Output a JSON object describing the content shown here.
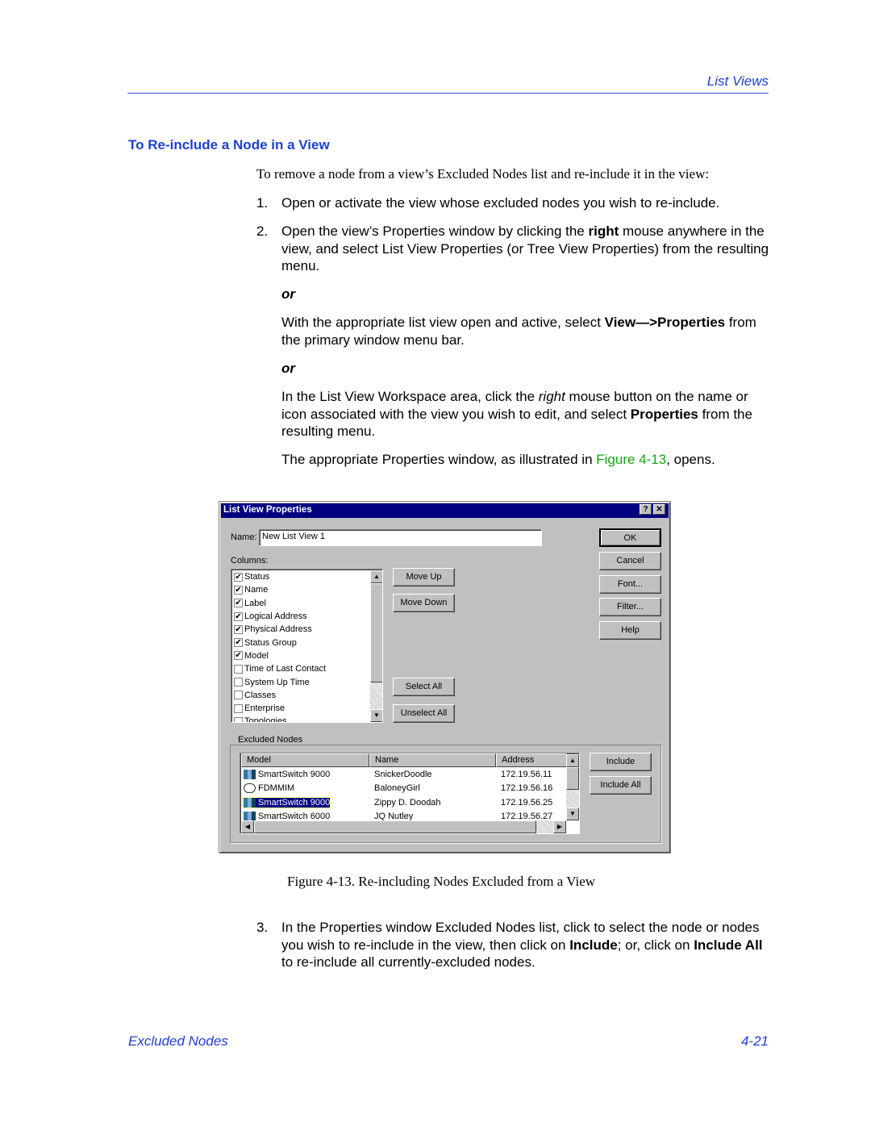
{
  "header": {
    "section": "List Views"
  },
  "heading": "To Re-include a Node in a View",
  "intro": "To remove a node from a view’s Excluded Nodes list and re-include it in the view:",
  "steps": [
    {
      "num": "1.",
      "text": "Open or activate the view whose excluded nodes you wish to re-include."
    },
    {
      "num": "2.",
      "pre": "Open the view’s Properties window by clicking the ",
      "bold": "right",
      "post": " mouse anywhere in the view, and select List View Properties (or Tree View Properties) from the resulting menu."
    },
    {
      "num": "3.",
      "pre": "In the Properties window Excluded Nodes list, click to select the node or nodes you wish to re-include in the view, then click on ",
      "bold": "Include",
      "mid": "; or, click on ",
      "bold2": "Include All",
      "post": " to re-include all currently-excluded nodes."
    }
  ],
  "or1": "or",
  "alt1": {
    "pre": "With the appropriate list view open and active, select ",
    "bold": "View—>Properties",
    "post": " from the primary window menu bar."
  },
  "or2": "or",
  "alt2": {
    "pre": "In the List View Workspace area, click the ",
    "italic": "right",
    "mid": " mouse button on the name or icon associated with the view you wish to edit, and select ",
    "bold": "Properties",
    "post": " from the resulting menu."
  },
  "result": {
    "pre": "The appropriate Properties window, as illustrated in ",
    "link": "Figure 4-13",
    "post": ", opens."
  },
  "dialog": {
    "title": "List View Properties",
    "help_btn": "?",
    "close_btn": "✕",
    "name_label": "Name:",
    "name_value": "New List View 1",
    "columns_label": "Columns:",
    "columns": [
      {
        "label": "Status",
        "checked": true
      },
      {
        "label": "Name",
        "checked": true
      },
      {
        "label": "Label",
        "checked": true
      },
      {
        "label": "Logical Address",
        "checked": true
      },
      {
        "label": "Physical Address",
        "checked": true
      },
      {
        "label": "Status Group",
        "checked": true
      },
      {
        "label": "Model",
        "checked": true
      },
      {
        "label": "Time of Last Contact",
        "checked": false
      },
      {
        "label": "System Up Time",
        "checked": false
      },
      {
        "label": "Classes",
        "checked": false
      },
      {
        "label": "Enterprise",
        "checked": false
      },
      {
        "label": "Topologies",
        "checked": false
      }
    ],
    "buttons": {
      "ok": "OK",
      "cancel": "Cancel",
      "font": "Font...",
      "filter": "Filter...",
      "help": "Help",
      "move_up": "Move Up",
      "move_down": "Move Down",
      "select_all": "Select All",
      "unselect_all": "Unselect All",
      "include": "Include",
      "include_all": "Include All"
    },
    "excluded_label": "Excluded Nodes",
    "excluded_headers": [
      "Model",
      "Name",
      "Address"
    ],
    "excluded_rows": [
      {
        "model": "SmartSwitch 9000",
        "name": "SnickerDoodle",
        "address": "172.19.56.11",
        "icon": "switch-icon",
        "selected": false
      },
      {
        "model": "FDMMIM",
        "name": "BaloneyGirl",
        "address": "172.19.56.16",
        "icon": "module-icon",
        "selected": false
      },
      {
        "model": "SmartSwitch 9000",
        "name": "Zippy D. Doodah",
        "address": "172.19.56.25",
        "icon": "switch-icon",
        "selected": true
      },
      {
        "model": "SmartSwitch 6000",
        "name": "JQ Nutley",
        "address": "172.19.56.27",
        "icon": "switch-icon",
        "selected": false
      }
    ]
  },
  "caption": "Figure 4-13.  Re-including Nodes Excluded from a View",
  "footer": {
    "left": "Excluded Nodes",
    "right": "4-21"
  },
  "colors": {
    "accent": "#1f3fcf",
    "link": "#11aa11",
    "titlebar": "#000080"
  }
}
